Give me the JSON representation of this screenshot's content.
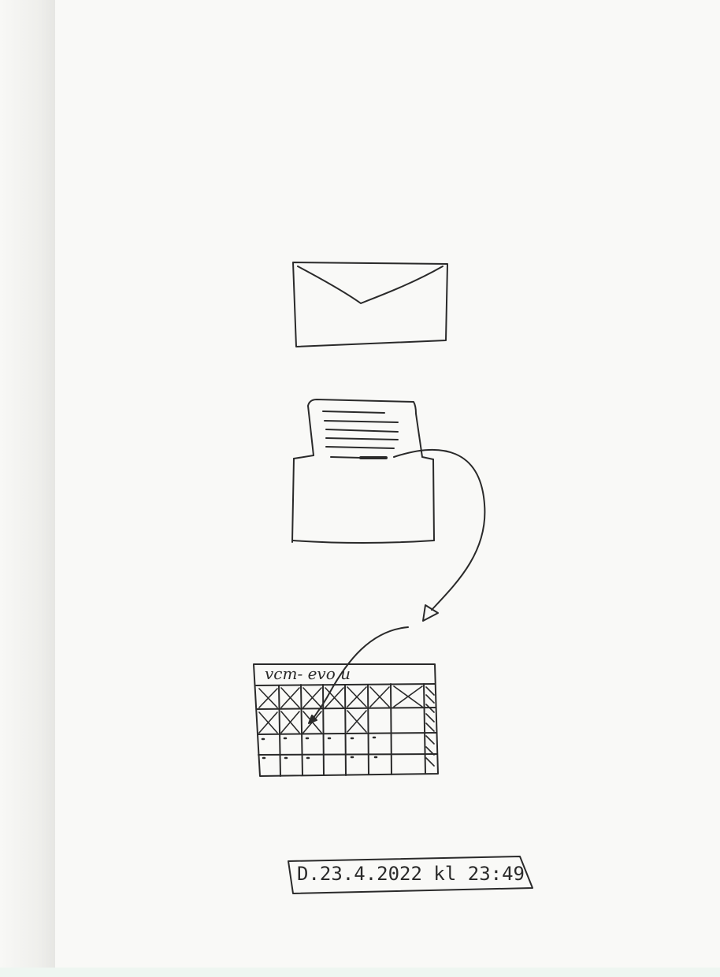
{
  "calendar": {
    "header_text": "vcm- evo u"
  },
  "timestamp": {
    "text": "D.23.4.2022 kl 23:49"
  },
  "icons": {
    "closed_envelope": "envelope-closed-icon",
    "open_envelope": "envelope-open-letter-icon",
    "arrow": "curved-arrow-icon",
    "calendar": "calendar-grid-icon"
  },
  "colors": {
    "ink": "#2a2a2a",
    "paper": "#f9f9f7"
  }
}
